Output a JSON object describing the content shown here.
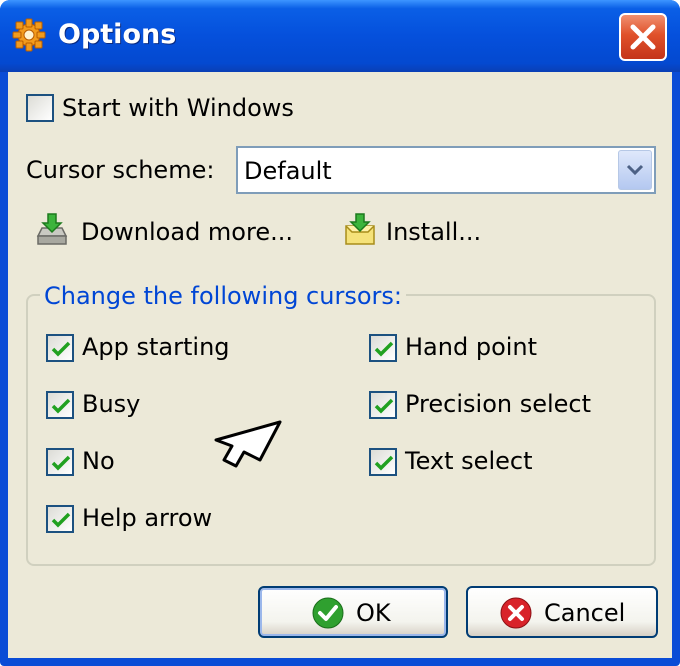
{
  "window": {
    "title": "Options"
  },
  "start_with_windows": {
    "label": "Start with Windows",
    "checked": false
  },
  "cursor_scheme": {
    "label": "Cursor scheme:",
    "value": "Default"
  },
  "download_more_label": "Download more...",
  "install_label": "Install...",
  "cursors_group": {
    "label": "Change the following cursors:",
    "items": [
      {
        "label": "App starting",
        "checked": true
      },
      {
        "label": "Busy",
        "checked": true
      },
      {
        "label": "No",
        "checked": true
      },
      {
        "label": "Help arrow",
        "checked": true
      },
      {
        "label": "Hand point",
        "checked": true
      },
      {
        "label": "Precision select",
        "checked": true
      },
      {
        "label": "Text select",
        "checked": true
      }
    ]
  },
  "buttons": {
    "ok": "OK",
    "cancel": "Cancel"
  },
  "colors": {
    "titlebar": "#0550dc",
    "client": "#ece9d8",
    "group_label": "#0046d5",
    "check": "#21a121",
    "close": "#e0512a"
  },
  "icons": [
    "gear-icon",
    "close-icon",
    "download-icon",
    "install-icon",
    "arrow-cursor-icon",
    "ok-icon",
    "cancel-icon"
  ]
}
